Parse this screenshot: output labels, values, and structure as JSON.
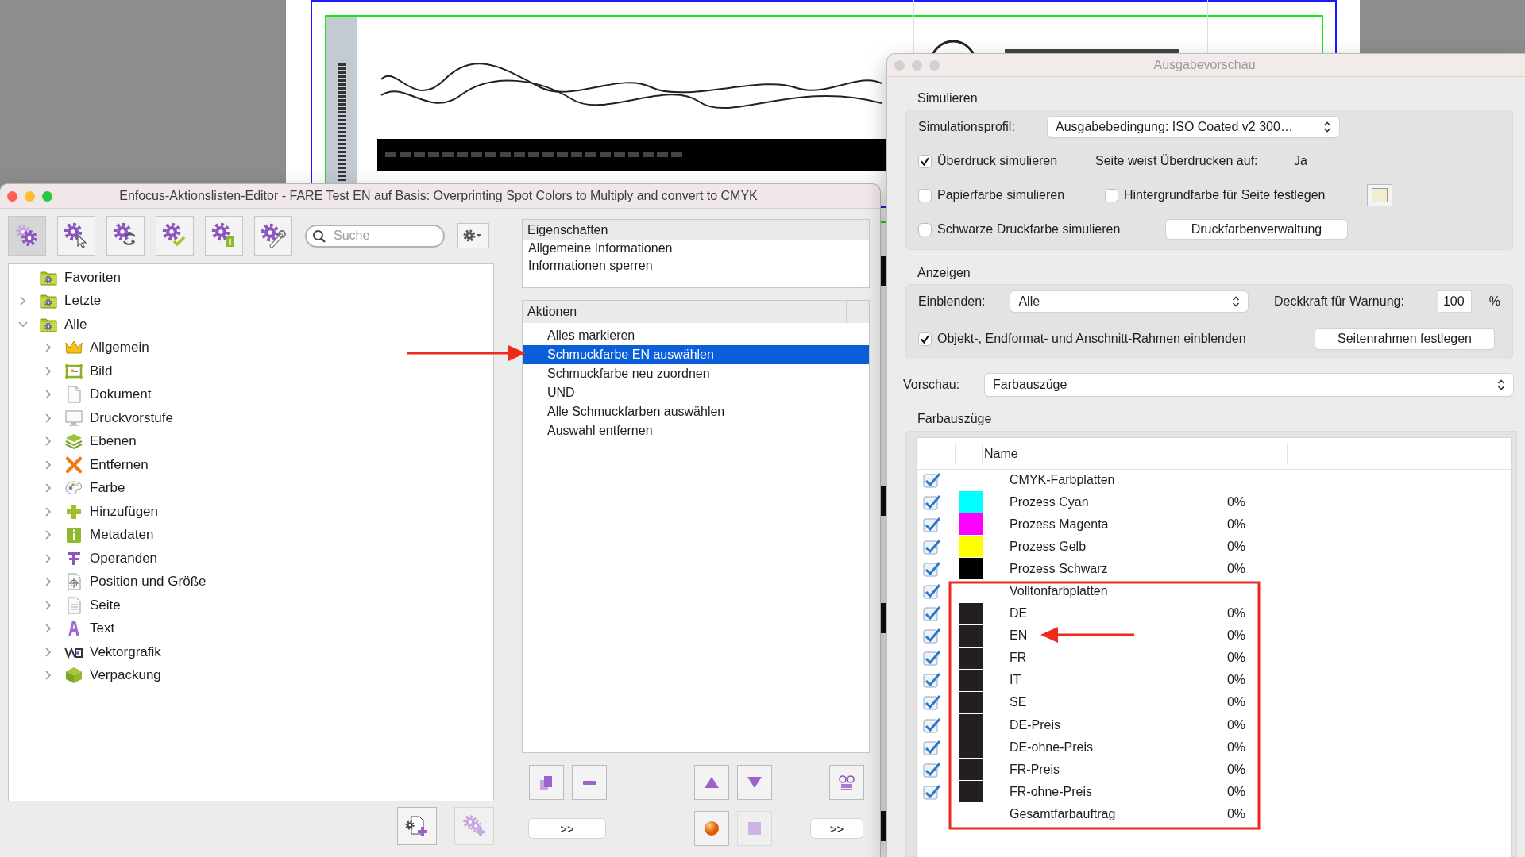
{
  "editor": {
    "title": "Enfocus-Aktionslisten-Editor - FARE Test EN auf Basis: Overprinting Spot Colors to Multiply and convert to CMYK",
    "toolbar": [
      {
        "selected": true
      },
      {
        "selected": false
      },
      {
        "selected": false
      },
      {
        "selected": false
      },
      {
        "selected": false
      },
      {
        "selected": false
      }
    ],
    "search": {
      "placeholder": "Suche"
    },
    "tree": [
      {
        "label": "Favoriten",
        "expandable": false
      },
      {
        "label": "Letzte",
        "expandable": true,
        "expanded": false
      },
      {
        "label": "Alle",
        "expandable": true,
        "expanded": true,
        "children": [
          {
            "label": "Allgemein",
            "expandable": true,
            "expanded": false
          },
          {
            "label": "Bild",
            "expandable": true,
            "expanded": false
          },
          {
            "label": "Dokument",
            "expandable": true,
            "expanded": false
          },
          {
            "label": "Druckvorstufe",
            "expandable": true,
            "expanded": false
          },
          {
            "label": "Ebenen",
            "expandable": true,
            "expanded": false
          },
          {
            "label": "Entfernen",
            "expandable": true,
            "expanded": false
          },
          {
            "label": "Farbe",
            "expandable": true,
            "expanded": false
          },
          {
            "label": "Hinzufügen",
            "expandable": true,
            "expanded": false
          },
          {
            "label": "Metadaten",
            "expandable": true,
            "expanded": false
          },
          {
            "label": "Operanden",
            "expandable": true,
            "expanded": false
          },
          {
            "label": "Position und Größe",
            "expandable": true,
            "expanded": false
          },
          {
            "label": "Seite",
            "expandable": true,
            "expanded": false
          },
          {
            "label": "Text",
            "expandable": true,
            "expanded": false
          },
          {
            "label": "Vektorgrafik",
            "expandable": true,
            "expanded": false
          },
          {
            "label": "Verpackung",
            "expandable": true,
            "expanded": false
          }
        ]
      }
    ],
    "footer_buttons": [
      {
        "disabled": false
      },
      {
        "disabled": true
      }
    ],
    "properties": {
      "header": "Eigenschaften",
      "items": [
        "Allgemeine Informationen",
        "Informationen sperren"
      ]
    },
    "actions": {
      "header": "Aktionen",
      "items": [
        {
          "label": "Alles markieren",
          "selected": false
        },
        {
          "label": "Schmuckfarbe EN auswählen",
          "selected": true
        },
        {
          "label": "Schmuckfarbe neu zuordnen",
          "selected": false
        },
        {
          "label": "UND",
          "selected": false
        },
        {
          "label": "Alle Schmuckfarben auswählen",
          "selected": false
        },
        {
          "label": "Auswahl entfernen",
          "selected": false
        }
      ]
    },
    "action_buttons": [
      {
        "disabled": false
      },
      {
        "disabled": false
      },
      {
        "disabled": false
      },
      {
        "disabled": false
      },
      {
        "disabled": false
      },
      {
        "disabled": false
      },
      {
        "disabled": true
      }
    ],
    "more_buttons": [
      ">>",
      ">>"
    ]
  },
  "preview": {
    "title": "Ausgabevorschau",
    "simulate": {
      "heading": "Simulieren",
      "profile_label": "Simulationsprofil:",
      "profile_value": "Ausgabebedingung: ISO Coated v2 300…",
      "overprint": {
        "label": "Überdruck simulieren",
        "checked": true
      },
      "overprint_info_label": "Seite weist Überdrucken auf:",
      "overprint_info_value": "Ja",
      "paper": {
        "label": "Papierfarbe simulieren",
        "checked": false
      },
      "background": {
        "label": "Hintergrundfarbe für Seite festlegen",
        "checked": false
      },
      "black_ink": {
        "label": "Schwarze Druckfarbe simulieren",
        "checked": false
      },
      "ink_manager_button": "Druckfarbenverwaltung"
    },
    "display": {
      "heading": "Anzeigen",
      "show_label": "Einblenden:",
      "show_value": "Alle",
      "opacity_label": "Deckkraft für Warnung:",
      "opacity_value": "100",
      "opacity_unit": "%",
      "frames": {
        "label": "Objekt-, Endformat- und Anschnitt-Rahmen einblenden",
        "checked": true
      },
      "page_frames_button": "Seitenrahmen festlegen"
    },
    "preview_label": "Vorschau:",
    "preview_value": "Farbauszüge",
    "separations": {
      "heading": "Farbauszüge",
      "columns": [
        "Name"
      ],
      "rows": [
        {
          "kind": "group",
          "name": "CMYK-Farbplatten",
          "checked": true
        },
        {
          "kind": "plate",
          "name": "Prozess Cyan",
          "color": "#00ffff",
          "coverage": "0%",
          "checked": true
        },
        {
          "kind": "plate",
          "name": "Prozess Magenta",
          "color": "#ff00ff",
          "coverage": "0%",
          "checked": true
        },
        {
          "kind": "plate",
          "name": "Prozess Gelb",
          "color": "#ffff00",
          "coverage": "0%",
          "checked": true
        },
        {
          "kind": "plate",
          "name": "Prozess Schwarz",
          "color": "#000000",
          "coverage": "0%",
          "checked": true
        },
        {
          "kind": "group",
          "name": "Volltonfarbplatten",
          "checked": true
        },
        {
          "kind": "plate",
          "name": "DE",
          "color": "#231f20",
          "coverage": "0%",
          "checked": true
        },
        {
          "kind": "plate",
          "name": "EN",
          "color": "#231f20",
          "coverage": "0%",
          "checked": true
        },
        {
          "kind": "plate",
          "name": "FR",
          "color": "#231f20",
          "coverage": "0%",
          "checked": true
        },
        {
          "kind": "plate",
          "name": "IT",
          "color": "#231f20",
          "coverage": "0%",
          "checked": true
        },
        {
          "kind": "plate",
          "name": "SE",
          "color": "#231f20",
          "coverage": "0%",
          "checked": true
        },
        {
          "kind": "plate",
          "name": "DE-Preis",
          "color": "#231f20",
          "coverage": "0%",
          "checked": true
        },
        {
          "kind": "plate",
          "name": "DE-ohne-Preis",
          "color": "#231f20",
          "coverage": "0%",
          "checked": true
        },
        {
          "kind": "plate",
          "name": "FR-Preis",
          "color": "#231f20",
          "coverage": "0%",
          "checked": true
        },
        {
          "kind": "plate",
          "name": "FR-ohne-Preis",
          "color": "#231f20",
          "coverage": "0%",
          "checked": true
        },
        {
          "kind": "total",
          "name": "Gesamtfarbauftrag",
          "coverage": "0%"
        }
      ]
    }
  }
}
